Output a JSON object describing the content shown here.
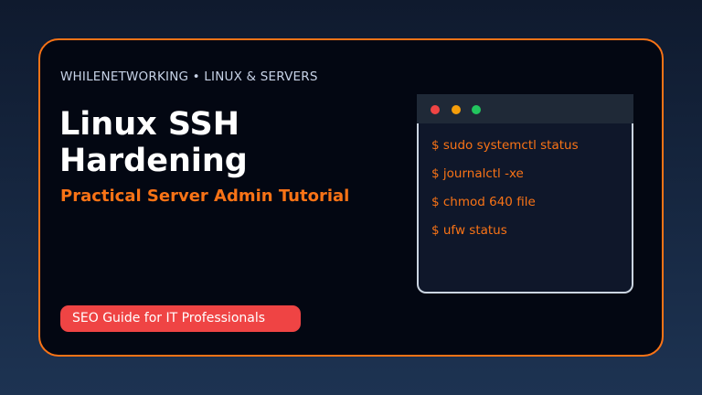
{
  "eyebrow": "WHILENETWORKING • LINUX & SERVERS",
  "title": "Linux SSH Hardening",
  "subtitle": "Practical Server Admin Tutorial",
  "badge": "SEO Guide for IT Professionals",
  "terminal": {
    "window_buttons": [
      "close",
      "minimize",
      "maximize"
    ],
    "lines": [
      "$ sudo systemctl status",
      "$ journalctl -xe",
      "$ chmod 640 file",
      "$ ufw status"
    ]
  },
  "colors": {
    "accent": "#f97316",
    "badge": "#ef4444",
    "card_bg": "#030712"
  }
}
